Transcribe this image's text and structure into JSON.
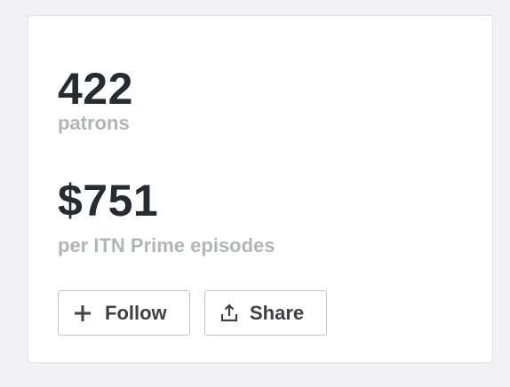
{
  "stats": {
    "patrons": {
      "value": "422",
      "label": "patrons"
    },
    "earnings": {
      "value": "$751",
      "label": "per ITN Prime episodes"
    }
  },
  "actions": {
    "follow_label": "Follow",
    "follow_icon": "plus-icon",
    "share_label": "Share",
    "share_icon": "share-icon"
  }
}
